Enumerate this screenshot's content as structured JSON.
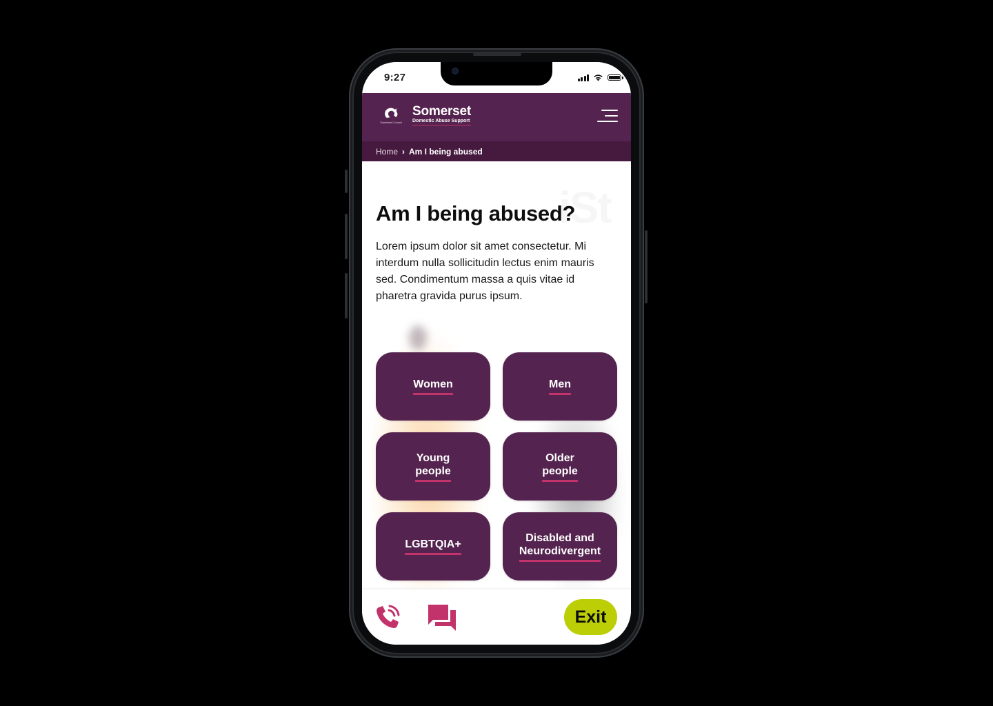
{
  "status_bar": {
    "time": "9:27"
  },
  "header": {
    "brand_name": "Somerset",
    "brand_subtitle": "Domestic Abuse Support",
    "council_label": "Somerset Council",
    "menu_icon": "hamburger-menu-icon"
  },
  "breadcrumb": {
    "home": "Home",
    "separator": "›",
    "current": "Am I being abused"
  },
  "main": {
    "title": "Am I being abused?",
    "intro": "Lorem ipsum dolor sit amet consectetur. Mi interdum nulla sollicitudin lectus enim mauris sed. Condimentum massa a quis vitae id pharetra gravida purus ipsum.",
    "tiles": [
      {
        "line1": "Women",
        "line2": ""
      },
      {
        "line1": "Men",
        "line2": ""
      },
      {
        "line1": "Young",
        "line2": "people"
      },
      {
        "line1": "Older",
        "line2": "people"
      },
      {
        "line1": "LGBTQIA+",
        "line2": ""
      },
      {
        "line1": "Disabled and",
        "line2": "Neurodivergent"
      }
    ]
  },
  "bottom_bar": {
    "call_icon": "phone-call-icon",
    "chat_icon": "chat-bubbles-icon",
    "exit_label": "Exit"
  },
  "colors": {
    "brand_purple": "#55234f",
    "breadcrumb_purple": "#46193f",
    "accent_pink": "#c2336b",
    "exit_lime": "#bccf06"
  }
}
